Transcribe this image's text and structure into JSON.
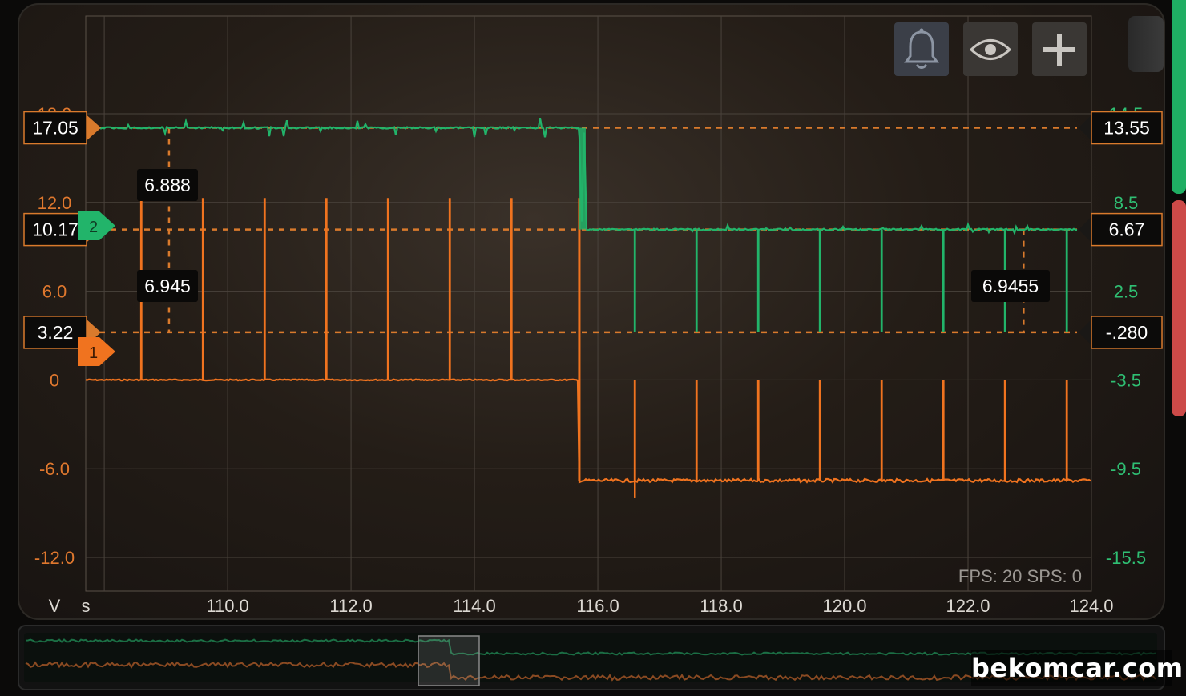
{
  "left_axis": {
    "unit": "V",
    "ticks": [
      {
        "label": "18.0",
        "value": 18
      },
      {
        "label": "12.0",
        "value": 12
      },
      {
        "label": "6.0",
        "value": 6
      },
      {
        "label": "0",
        "value": 0
      },
      {
        "label": "-6.0",
        "value": -6
      },
      {
        "label": "-12.0",
        "value": -12
      }
    ],
    "range": [
      -12,
      18
    ]
  },
  "right_axis": {
    "ticks": [
      {
        "label": "14.5",
        "value": 14.5
      },
      {
        "label": "8.5",
        "value": 8.5
      },
      {
        "label": "2.5",
        "value": 2.5
      },
      {
        "label": "-3.5",
        "value": -3.5
      },
      {
        "label": "-9.5",
        "value": -9.5
      },
      {
        "label": "-15.5",
        "value": -15.5
      }
    ],
    "range": [
      -15.5,
      14.5
    ]
  },
  "x_axis": {
    "unit": "s",
    "ticks": [
      "110.0",
      "112.0",
      "114.0",
      "116.0",
      "118.0",
      "120.0",
      "122.0",
      "124.0"
    ],
    "range": [
      107.7,
      124.0
    ]
  },
  "cursor_levels_left": [
    {
      "label": "17.05",
      "value": 17.05
    },
    {
      "label": "10.17",
      "value": 10.17
    },
    {
      "label": "3.22",
      "value": 3.22
    }
  ],
  "cursor_levels_right": [
    {
      "label": "13.55",
      "value": 13.55
    },
    {
      "label": "6.67",
      "value": 6.67
    },
    {
      "label": "-.280",
      "value": -0.28
    }
  ],
  "measurements": {
    "m1": "6.888",
    "m2": "6.945",
    "m3": "6.9455"
  },
  "channel_markers": {
    "ch1": "1",
    "ch2": "2"
  },
  "stats": "FPS: 20  SPS: 0",
  "watermark": "bekomcar.com",
  "colors": {
    "channel1": "#f0731f",
    "channel2": "#22b46a",
    "grid": "#4a433c",
    "cursor": "#d97a2c"
  },
  "toolbar": {
    "icons": [
      "bell-icon",
      "eye-icon",
      "plus-icon"
    ]
  },
  "chart_data": {
    "type": "line",
    "xlabel": "s",
    "ylabel": "V",
    "xlim": [
      107.7,
      124.0
    ],
    "ylim": [
      -12,
      18
    ],
    "y2lim": [
      -15.5,
      14.5
    ],
    "grid": true,
    "series": [
      {
        "axis": "left",
        "pulse_times_before": [
          108.6,
          109.6,
          110.6,
          111.6,
          112.6,
          113.6,
          114.6
        ],
        "pulse_times_after": [
          116.6,
          117.6,
          118.6,
          119.6,
          120.6,
          121.6,
          122.6,
          123.6
        ],
        "baseline_before": 0,
        "baseline_after": -6.8,
        "pulse_peak_before": 12.3,
        "pulse_peak_after": 0,
        "switch_time": 115.7
      },
      {
        "axis": "right",
        "pulse_times_after": [
          116.6,
          117.6,
          118.6,
          119.6,
          120.6,
          121.6,
          122.6,
          123.6
        ],
        "baseline_before": 13.55,
        "baseline_after": 6.67,
        "pulse_low_after": -0.28,
        "switch_time": 115.7
      }
    ]
  }
}
